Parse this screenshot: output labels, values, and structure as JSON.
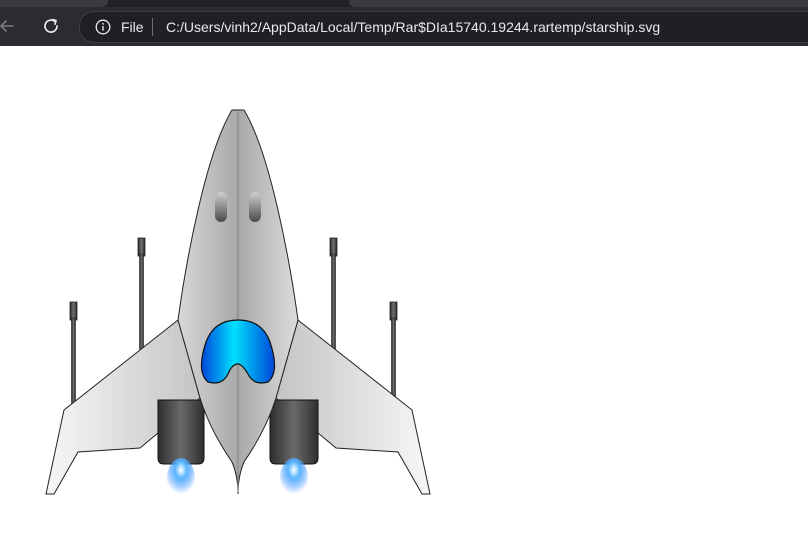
{
  "browser": {
    "address_bar": {
      "scheme_label": "File",
      "url": "C:/Users/vinh2/AppData/Local/Temp/Rar$DIa15740.19244.rartemp/starship.svg"
    },
    "icons": {
      "back": "arrow-left-icon",
      "reload": "reload-icon",
      "info": "info-icon"
    }
  },
  "content": {
    "image_subject": "starship",
    "colors": {
      "hull_light": "#f2f2f2",
      "hull_mid": "#bdbdbd",
      "engine_dark": "#3a3a3a",
      "cockpit_blue": "#00b4ff",
      "cockpit_deep": "#0050e0",
      "flame": "#3da0ff"
    }
  }
}
